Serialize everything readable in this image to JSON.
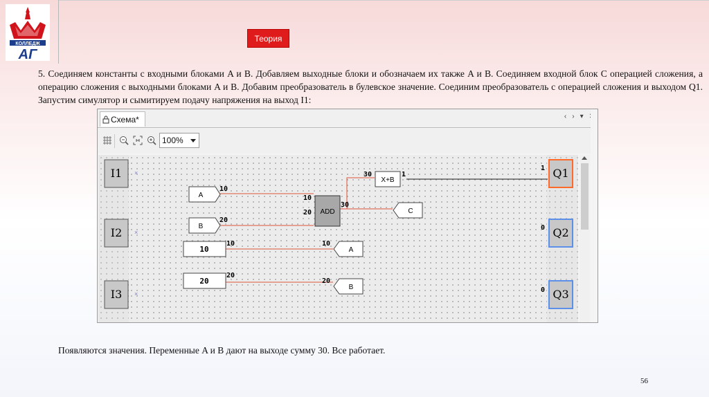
{
  "header": {
    "theory_button": "Теория"
  },
  "instruction_text": "5. Соединяем константы с входными блоками A и B.  Добавляем выходные блоки и обозначаем их также A и B. Соединяем входной блок С операцией сложения, а операцию сложения с выходными блоками A и B. Добавим преобразователь в булевское значение. Соединим преобразователь с операцией сложения и выходом Q1. Запустим симулятор и сымитируем подачу напряжения на выход I1:",
  "editor": {
    "tab_title": "Схема*",
    "zoom_value": "100%",
    "tab_controls": [
      "‹",
      "›",
      "▾",
      "✕"
    ]
  },
  "diagram": {
    "inputs": [
      {
        "label": "I1"
      },
      {
        "label": "I2"
      },
      {
        "label": "I3"
      }
    ],
    "outputs": [
      {
        "label": "Q1",
        "value": "1",
        "state_color": "#ff6a2a"
      },
      {
        "label": "Q2",
        "value": "0",
        "state_color": "#5b8fe8"
      },
      {
        "label": "Q3",
        "value": "0",
        "state_color": "#5b8fe8"
      }
    ],
    "var_inputs": [
      {
        "name": "A",
        "value": "10"
      },
      {
        "name": "B",
        "value": "20"
      }
    ],
    "constants": [
      {
        "value": "10",
        "out": "10"
      },
      {
        "value": "20",
        "out": "20"
      }
    ],
    "add_block": {
      "label": "ADD",
      "in1": "10",
      "in2": "20",
      "out": "30"
    },
    "converter": {
      "label": "X+B",
      "in": "30",
      "out": "1"
    },
    "var_outputs": [
      {
        "name": "C",
        "value": ""
      },
      {
        "name": "A",
        "value": "10"
      },
      {
        "name": "B",
        "value": "20"
      }
    ],
    "wire_color": "#e0533a",
    "bool_wire_color": "#1a1a1a"
  },
  "conclusion": "Появляются значения. Переменные A и B дают на выходе сумму 30. Все работает.",
  "page_number": "56"
}
